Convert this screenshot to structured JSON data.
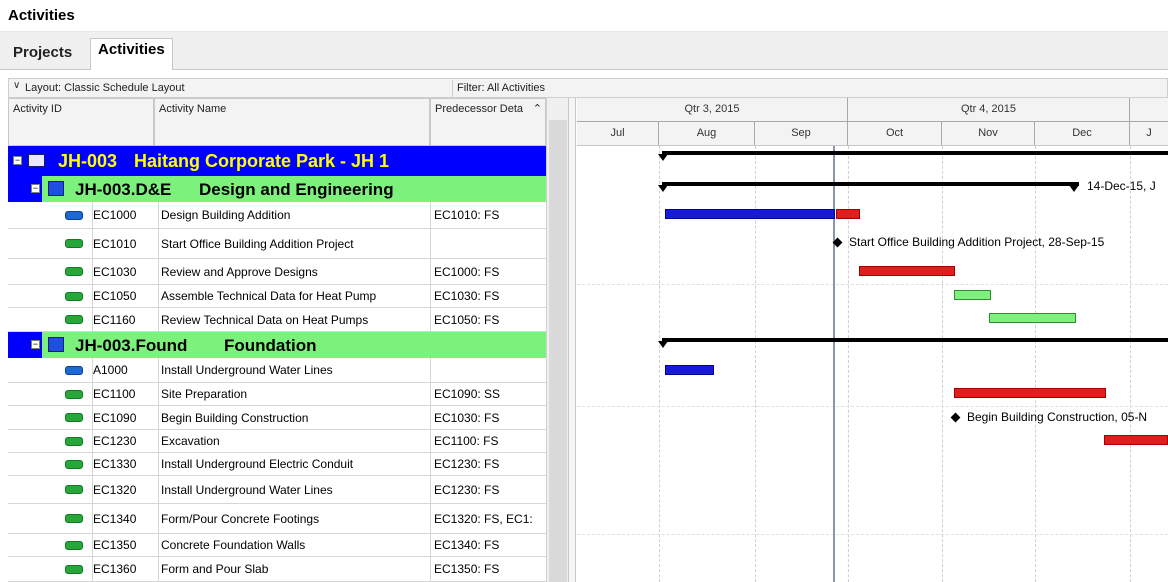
{
  "window": {
    "title": "Activities"
  },
  "tabs": [
    {
      "label": "Projects"
    },
    {
      "label": "Activities"
    }
  ],
  "options_bar": {
    "layout": "Layout: Classic Schedule Layout",
    "filter": "Filter: All Activities"
  },
  "columns": {
    "activity_id": "Activity ID",
    "activity_name": "Activity Name",
    "predecessor": "Predecessor Deta"
  },
  "timescale": {
    "quarters": [
      "Qtr 3, 2015",
      "Qtr 4, 2015"
    ],
    "months": [
      "Jul",
      "Aug",
      "Sep",
      "Oct",
      "Nov",
      "Dec",
      "J"
    ]
  },
  "project": {
    "code": "JH-003",
    "name": "Haitang Corporate Park - JH 1"
  },
  "wbs": [
    {
      "code": "JH-003.D&E",
      "name": "Design and Engineering",
      "finish_label": "14-Dec-15, J"
    },
    {
      "code": "JH-003.Found",
      "name": "Foundation"
    }
  ],
  "activities": [
    {
      "id": "EC1000",
      "name": "Design Building Addition",
      "pred": "EC1010: FS",
      "icon": "blue"
    },
    {
      "id": "EC1010",
      "name": "Start Office Building Addition Project",
      "pred": "",
      "icon": "green",
      "label": "Start Office Building Addition Project, 28-Sep-15"
    },
    {
      "id": "EC1030",
      "name": "Review and Approve Designs",
      "pred": "EC1000: FS",
      "icon": "green"
    },
    {
      "id": "EC1050",
      "name": "Assemble Technical Data for Heat Pump",
      "pred": "EC1030: FS",
      "icon": "green"
    },
    {
      "id": "EC1160",
      "name": "Review Technical Data on Heat Pumps",
      "pred": "EC1050: FS",
      "icon": "green"
    },
    {
      "id": "A1000",
      "name": "Install Underground Water Lines",
      "pred": "",
      "icon": "blue"
    },
    {
      "id": "EC1100",
      "name": "Site Preparation",
      "pred": "EC1090: SS",
      "icon": "green"
    },
    {
      "id": "EC1090",
      "name": "Begin Building Construction",
      "pred": "EC1030: FS",
      "icon": "green",
      "label": "Begin Building Construction, 05-N"
    },
    {
      "id": "EC1230",
      "name": "Excavation",
      "pred": "EC1100: FS",
      "icon": "green"
    },
    {
      "id": "EC1330",
      "name": "Install Underground Electric Conduit",
      "pred": "EC1230: FS",
      "icon": "green"
    },
    {
      "id": "EC1320",
      "name": "Install Underground Water Lines",
      "pred": "EC1230: FS",
      "icon": "green"
    },
    {
      "id": "EC1340",
      "name": "Form/Pour Concrete Footings",
      "pred": "EC1320: FS, EC1:",
      "icon": "green"
    },
    {
      "id": "EC1350",
      "name": "Concrete Foundation Walls",
      "pred": "EC1340: FS",
      "icon": "green"
    },
    {
      "id": "EC1360",
      "name": "Form and Pour Slab",
      "pred": "EC1350: FS",
      "icon": "green"
    }
  ],
  "colors": {
    "project_band": "#0000ff",
    "project_text": "#ffff00",
    "wbs_band": "#7cf27c",
    "critical_bar": "#e01e1e",
    "remaining_bar": "#1a1ad6",
    "noncritical_bar": "#7ef07e"
  }
}
